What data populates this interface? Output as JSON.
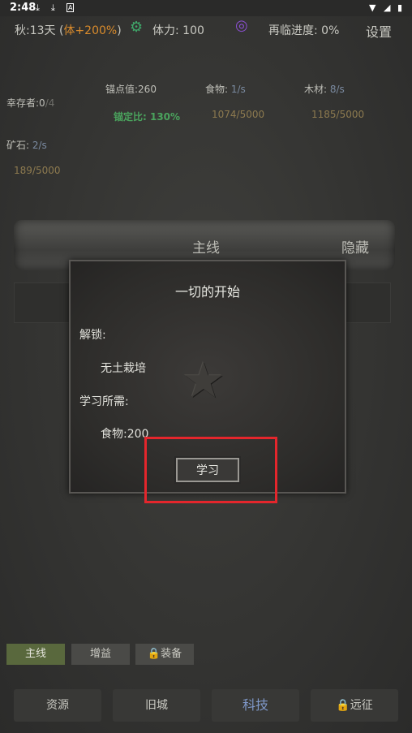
{
  "status_bar": {
    "time": "2:48",
    "icons": [
      "download-icon",
      "download-icon",
      "a-icon",
      "wifi-icon",
      "signal-icon",
      "battery-icon"
    ]
  },
  "top": {
    "season_day": "秋:13天 (",
    "bonus": "体+200%",
    "bonus_close": ")",
    "stamina": "体力: 100",
    "revisit": "再临进度: 0%",
    "settings": "设置"
  },
  "resources": {
    "survivors_label": "幸存者:0",
    "survivors_max": "/4",
    "anchor_value": "锚点值:260",
    "anchor_ratio": "锚定比: 130%",
    "food_label": "食物:",
    "food_rate": "1/s",
    "food_amount": "1074/5000",
    "wood_label": "木材:",
    "wood_rate": "8/s",
    "wood_amount": "1185/5000",
    "ore_label": "矿石:",
    "ore_rate": "2/s",
    "ore_amount": "189/5000"
  },
  "main_bar": {
    "title": "主线",
    "hide": "隐藏"
  },
  "dialog": {
    "title": "一切的开始",
    "unlock_label": "解锁:",
    "unlock_item": "无土栽培",
    "cost_label": "学习所需:",
    "cost_item": "食物:200",
    "learn_button": "学习"
  },
  "tabs": {
    "main": "主线",
    "buff": "增益",
    "equip": "🔒装备"
  },
  "nav": {
    "resources": "资源",
    "old_city": "旧城",
    "tech": "科技",
    "expedition": "🔒远征"
  },
  "colors": {
    "accent_orange": "#d98b2c",
    "highlight_red": "#e4262c",
    "active_tab_green": "#59683d",
    "tech_blue": "#7f98c9"
  }
}
